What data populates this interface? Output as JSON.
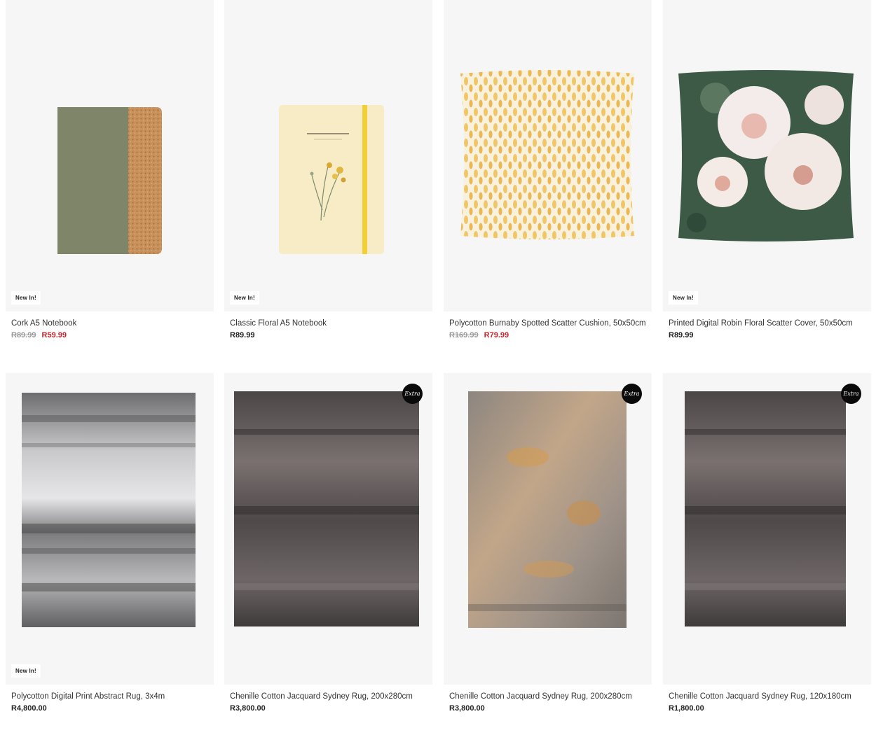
{
  "products": [
    {
      "name": "Cork A5 Notebook",
      "badge": "New In!",
      "price_old": "R89.99",
      "price_sale": "R59.99",
      "price": "",
      "image": "cork-notebook"
    },
    {
      "name": "Classic Floral A5 Notebook",
      "badge": "New In!",
      "price_old": "",
      "price_sale": "",
      "price": "R89.99",
      "image": "floral-notebook"
    },
    {
      "name": "Polycotton Burnaby Spotted Scatter Cushion, 50x50cm",
      "badge": "",
      "price_old": "R169.99",
      "price_sale": "R79.99",
      "price": "",
      "image": "spotted-cushion"
    },
    {
      "name": "Printed Digital Robin Floral Scatter Cover, 50x50cm",
      "badge": "New In!",
      "price_old": "",
      "price_sale": "",
      "price": "R89.99",
      "image": "floral-cushion"
    },
    {
      "name": "Polycotton Digital Print Abstract Rug, 3x4m",
      "badge": "New In!",
      "price_old": "",
      "price_sale": "",
      "price": "R4,800.00",
      "image": "grey-abstract-rug"
    },
    {
      "name": "Chenille Cotton Jacquard Sydney Rug, 200x280cm",
      "badge": "",
      "extra": "Extra",
      "price_old": "",
      "price_sale": "",
      "price": "R3,800.00",
      "image": "charcoal-rug"
    },
    {
      "name": "Chenille Cotton Jacquard Sydney Rug, 200x280cm",
      "badge": "",
      "extra": "Extra",
      "price_old": "",
      "price_sale": "",
      "price": "R3,800.00",
      "image": "ochre-rug"
    },
    {
      "name": "Chenille Cotton Jacquard Sydney Rug, 120x180cm",
      "badge": "",
      "extra": "Extra",
      "price_old": "",
      "price_sale": "",
      "price": "R1,800.00",
      "image": "charcoal-rug"
    }
  ],
  "colors": {
    "sale": "#c6252b",
    "old_price": "#9a9a9a",
    "tile_bg": "#f6f6f6"
  }
}
